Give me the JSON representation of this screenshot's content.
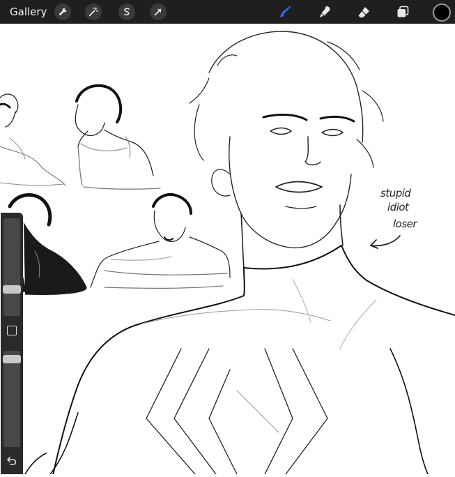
{
  "topbar": {
    "gallery_label": "Gallery",
    "actions_icons": [
      "wrench-icon",
      "magic-wand-icon",
      "selection-icon",
      "transform-arrow-icon"
    ],
    "tools_icons": [
      "brush-icon",
      "smudge-icon",
      "eraser-icon",
      "layers-icon"
    ],
    "active_tool": "brush",
    "accent_color": "#2f6bff",
    "current_color": "#000000"
  },
  "sidebar": {
    "brush_size_level": 0.25,
    "opacity_level": 0.05,
    "undo_icon": "undo-icon",
    "modify_icon": "square-icon"
  },
  "canvas": {
    "note_lines": [
      "stupid",
      "idiot",
      "loser"
    ]
  }
}
